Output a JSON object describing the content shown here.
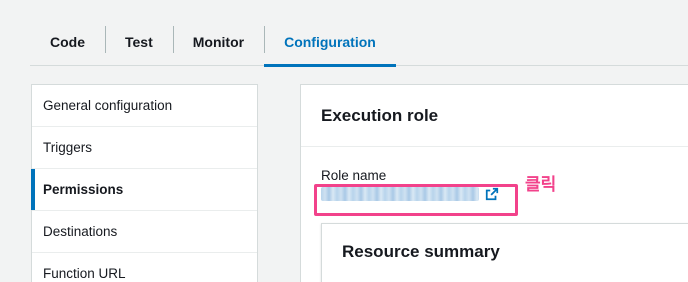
{
  "tabs": [
    {
      "label": "Code"
    },
    {
      "label": "Test"
    },
    {
      "label": "Monitor"
    },
    {
      "label": "Configuration",
      "active": true
    }
  ],
  "sidenav": {
    "items": [
      {
        "label": "General configuration"
      },
      {
        "label": "Triggers"
      },
      {
        "label": "Permissions",
        "active": true
      },
      {
        "label": "Destinations"
      },
      {
        "label": "Function URL"
      }
    ]
  },
  "execution_role": {
    "title": "Execution role",
    "role_label": "Role name",
    "role_link_icon": "external-link-icon",
    "annotation": "클릭"
  },
  "resource_summary": {
    "title": "Resource summary"
  },
  "colors": {
    "accent": "#0073bb",
    "annotation": "#f2428b",
    "background": "#f2f3f3"
  }
}
